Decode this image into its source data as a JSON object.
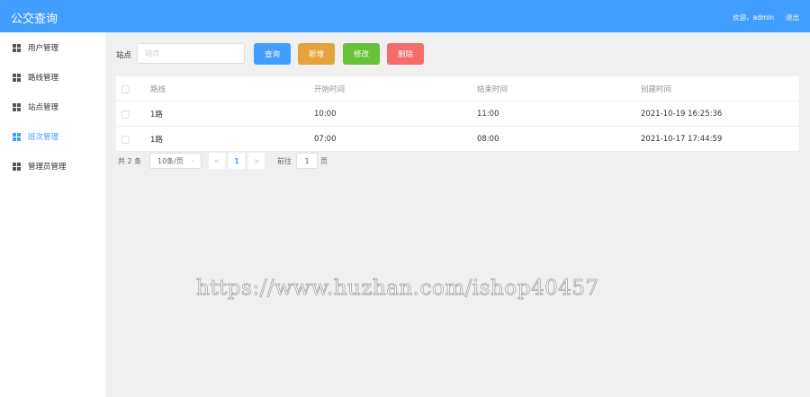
{
  "header": {
    "title": "公交查询",
    "welcome": "欢迎，admin",
    "logout": "退出"
  },
  "sidebar": {
    "items": [
      {
        "label": "用户管理",
        "icon": "grid-icon",
        "active": false
      },
      {
        "label": "路线管理",
        "icon": "grid-icon",
        "active": false
      },
      {
        "label": "站点管理",
        "icon": "grid-icon",
        "active": false
      },
      {
        "label": "班次管理",
        "icon": "grid-icon",
        "active": true
      },
      {
        "label": "管理员管理",
        "icon": "grid-icon",
        "active": false
      }
    ]
  },
  "search": {
    "label": "站点",
    "placeholder": "站点",
    "value": ""
  },
  "toolbar": {
    "query": "查询",
    "add": "新增",
    "edit": "修改",
    "delete": "删除"
  },
  "table": {
    "columns": [
      "路线",
      "开始时间",
      "结束时间",
      "创建时间"
    ],
    "rows": [
      {
        "route": "1路",
        "start": "10:00",
        "end": "11:00",
        "created": "2021-10-19 16:25:36"
      },
      {
        "route": "1路",
        "start": "07:00",
        "end": "08:00",
        "created": "2021-10-17 17:44:59"
      }
    ]
  },
  "pagination": {
    "total": "共 2 条",
    "page_size": "10条/页",
    "current_page": "1",
    "goto_label": "前往",
    "goto_value": "1",
    "page_unit": "页"
  },
  "watermark": "https://www.huzhan.com/ishop40457",
  "colors": {
    "primary": "#409eff",
    "warning": "#e6a23c",
    "success": "#67c23a",
    "danger": "#f56c6c"
  }
}
